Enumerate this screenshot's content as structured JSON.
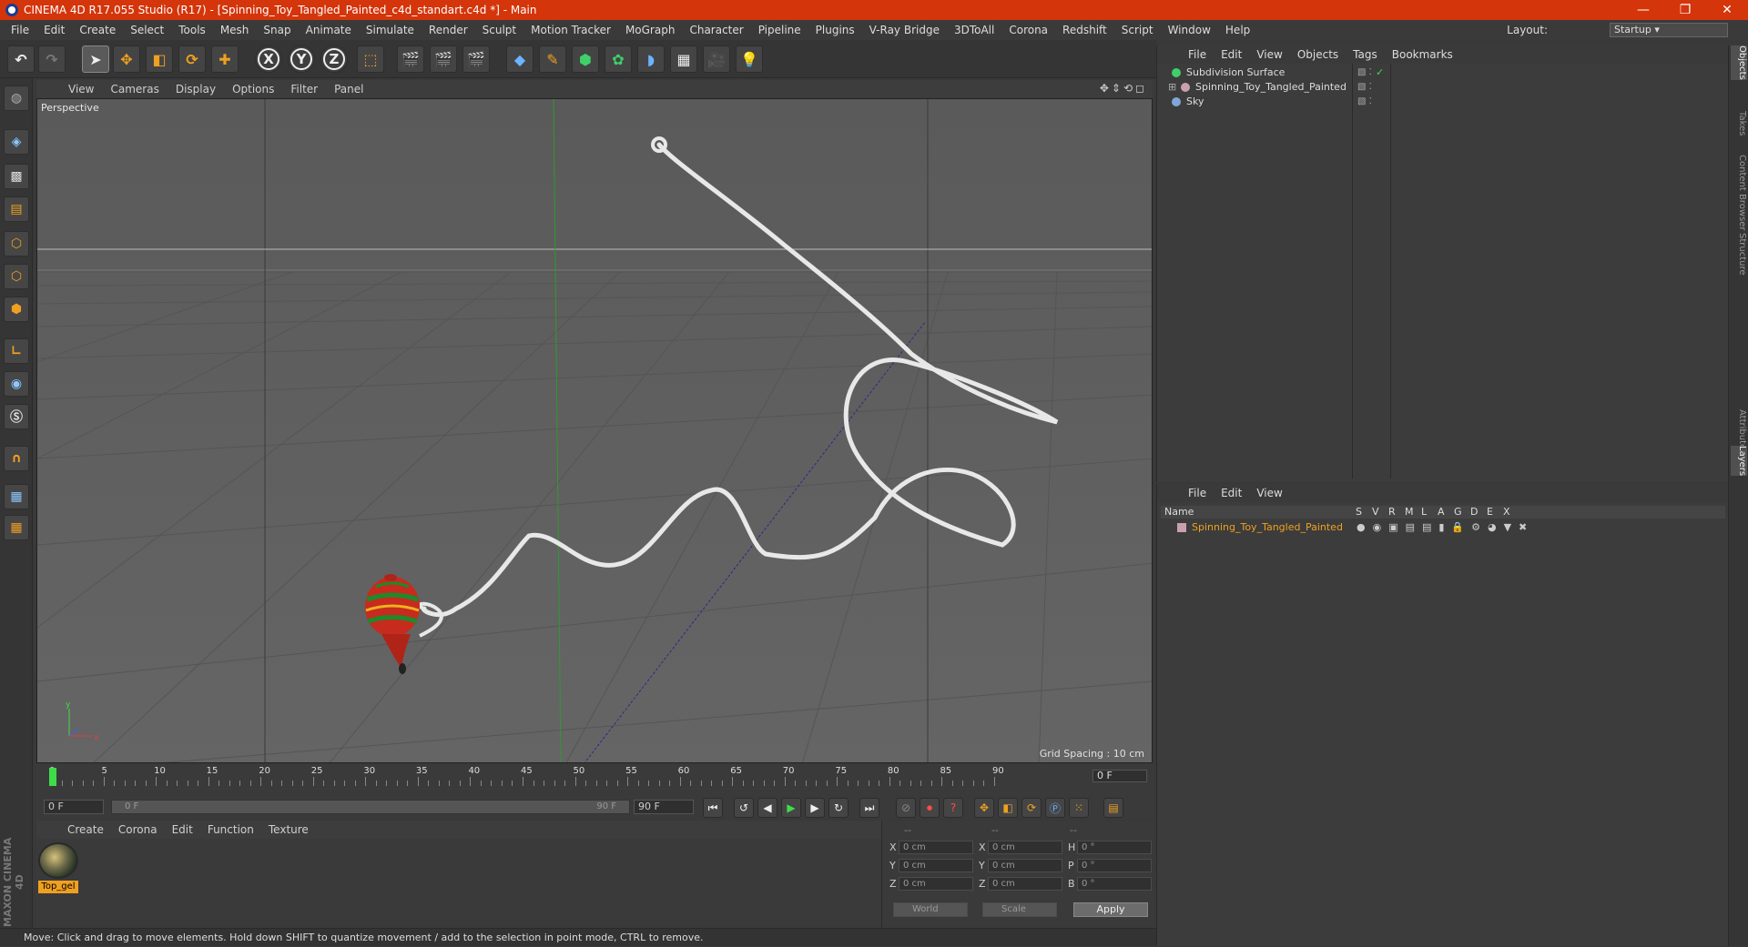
{
  "window": {
    "title": "CINEMA 4D R17.055 Studio (R17) - [Spinning_Toy_Tangled_Painted_c4d_standart.c4d *] - Main",
    "controls": [
      "—",
      "❐",
      "✕"
    ]
  },
  "menubar": {
    "items": [
      "File",
      "Edit",
      "Create",
      "Select",
      "Tools",
      "Mesh",
      "Snap",
      "Animate",
      "Simulate",
      "Render",
      "Sculpt",
      "Motion Tracker",
      "MoGraph",
      "Character",
      "Pipeline",
      "Plugins",
      "V-Ray Bridge",
      "3DToAll",
      "Corona",
      "Redshift",
      "Script",
      "Window",
      "Help"
    ],
    "layout_label": "Layout:",
    "layout_value": "Startup"
  },
  "toolbar": {
    "undo": "↶",
    "redo": "↷",
    "axis_x": "X",
    "axis_y": "Y",
    "axis_z": "Z"
  },
  "viewport": {
    "menu": [
      "View",
      "Cameras",
      "Display",
      "Options",
      "Filter",
      "Panel"
    ],
    "nav_icons": "✥⇕⟲◻",
    "camera": "Perspective",
    "grid_spacing": "Grid Spacing : 10 cm"
  },
  "timeline": {
    "ticks": [
      "0",
      "5",
      "10",
      "15",
      "20",
      "25",
      "30",
      "35",
      "40",
      "45",
      "50",
      "55",
      "60",
      "65",
      "70",
      "75",
      "80",
      "85",
      "90"
    ],
    "current_frame": "0 F",
    "start_field": "0 F",
    "range_start": "0 F",
    "range_end": "90 F",
    "end_field": "90 F"
  },
  "material_manager": {
    "menu": [
      "Create",
      "Corona",
      "Edit",
      "Function",
      "Texture"
    ],
    "material_name": "Top_gel"
  },
  "coordinates": {
    "header": [
      "--",
      "--",
      "--"
    ],
    "rows": [
      {
        "l1": "X",
        "v1": "0 cm",
        "l2": "X",
        "v2": "0 cm",
        "l3": "H",
        "v3": "0 °"
      },
      {
        "l1": "Y",
        "v1": "0 cm",
        "l2": "Y",
        "v2": "0 cm",
        "l3": "P",
        "v3": "0 °"
      },
      {
        "l1": "Z",
        "v1": "0 cm",
        "l2": "Z",
        "v2": "0 cm",
        "l3": "B",
        "v3": "0 °"
      }
    ],
    "space": "World",
    "mode": "Scale",
    "apply": "Apply"
  },
  "object_manager": {
    "menu": [
      "File",
      "Edit",
      "View",
      "Objects",
      "Tags",
      "Bookmarks"
    ],
    "objects": [
      {
        "name": "Subdivision Surface",
        "color": "#3fd06a"
      },
      {
        "name": "Spinning_Toy_Tangled_Painted",
        "color": "#c8a0b0"
      },
      {
        "name": "Sky",
        "color": "#7fa8d8"
      }
    ]
  },
  "layer_manager": {
    "menu": [
      "File",
      "Edit",
      "View"
    ],
    "columns": [
      "Name",
      "S",
      "V",
      "R",
      "M",
      "L",
      "A",
      "G",
      "D",
      "E",
      "X"
    ],
    "layer_name": "Spinning_Toy_Tangled_Painted",
    "layer_color": "#f0a020"
  },
  "side_tabs": [
    "Objects",
    "Takes",
    "Content Browser",
    "Structure",
    "Attributes",
    "Layers"
  ],
  "status": "Move: Click and drag to move elements. Hold down SHIFT to quantize movement / add to the selection in point mode, CTRL to remove.",
  "brand": "MAXON CINEMA 4D"
}
